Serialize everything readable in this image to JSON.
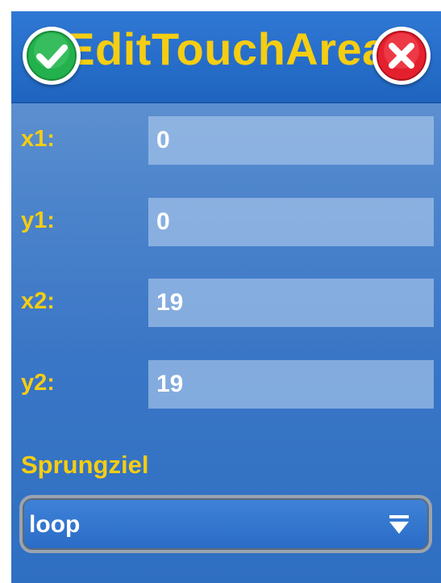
{
  "dialog": {
    "title": "EditTouchArea",
    "ok_icon": "checkmark-circle-icon",
    "cancel_icon": "close-circle-icon"
  },
  "fields": [
    {
      "label": "x1:",
      "value": "0"
    },
    {
      "label": "y1:",
      "value": "0"
    },
    {
      "label": "x2:",
      "value": "19"
    },
    {
      "label": "y2:",
      "value": "19"
    }
  ],
  "jump_target": {
    "label": "Sprungziel",
    "selected": "loop",
    "icon": "dropdown-arrow-icon"
  },
  "colors": {
    "accent": "#f5cd12",
    "background": "#3a76c6",
    "titlebar": "#1f65c0",
    "field": "#aac8eb",
    "ok_green": "#22b14c",
    "cancel_red": "#e4202e"
  }
}
